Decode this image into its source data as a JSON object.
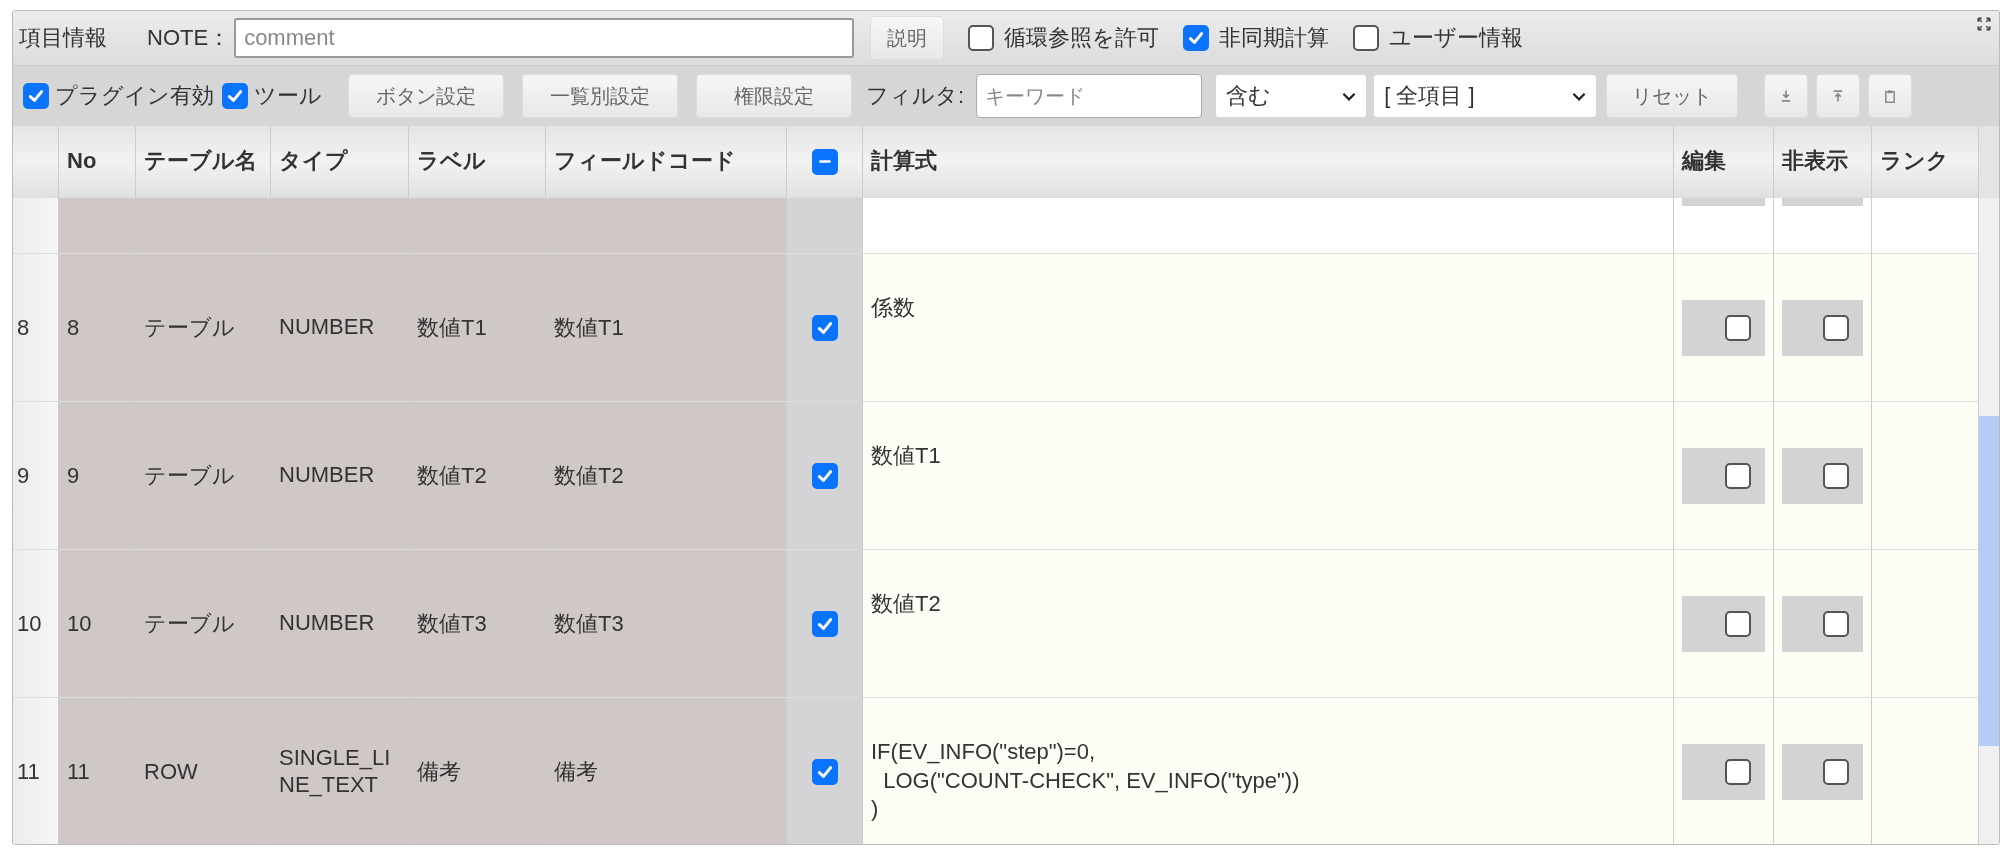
{
  "top_bar": {
    "title": "項目情報",
    "note_label": "NOTE：",
    "note_placeholder": "comment",
    "help_button": "説明",
    "options": [
      {
        "label": "循環参照を許可",
        "checked": false
      },
      {
        "label": "非同期計算",
        "checked": true
      },
      {
        "label": "ユーザー情報",
        "checked": false
      }
    ]
  },
  "toolbar": {
    "toggles": [
      {
        "label": "プラグイン有効",
        "checked": true
      },
      {
        "label": "ツール",
        "checked": true
      }
    ],
    "buttons": [
      "ボタン設定",
      "一覧別設定",
      "権限設定"
    ],
    "filter_label": "フィルタ:",
    "keyword_placeholder": "キーワード",
    "match_select": "含む",
    "field_select": "[ 全項目 ]",
    "reset_button": "リセット"
  },
  "table": {
    "columns": [
      "No",
      "テーブル名",
      "タイプ",
      "ラベル",
      "フィールドコード",
      "計算式",
      "編集",
      "非表示",
      "ランク"
    ],
    "calc_header_indeterminate": true,
    "rows": [
      {
        "row_head": "8",
        "no": "8",
        "table": "テーブル",
        "type": "NUMBER",
        "label": "数値T1",
        "field_code": "数値T1",
        "calc": true,
        "formula": "係数",
        "edit": false,
        "hidden": false
      },
      {
        "row_head": "9",
        "no": "9",
        "table": "テーブル",
        "type": "NUMBER",
        "label": "数値T2",
        "field_code": "数値T2",
        "calc": true,
        "formula": "数値T1",
        "edit": false,
        "hidden": false
      },
      {
        "row_head": "10",
        "no": "10",
        "table": "テーブル",
        "type": "NUMBER",
        "label": "数値T3",
        "field_code": "数値T3",
        "calc": true,
        "formula": "数値T2",
        "edit": false,
        "hidden": false
      },
      {
        "row_head": "11",
        "no": "11",
        "table": "ROW",
        "type": "SINGLE_LINE_TEXT",
        "label": "備考",
        "field_code": "備考",
        "calc": true,
        "formula": "IF(EV_INFO(\"step\")=0,\n  LOG(\"COUNT-CHECK\", EV_INFO(\"type\"))\n)",
        "edit": false,
        "hidden": false
      }
    ]
  }
}
